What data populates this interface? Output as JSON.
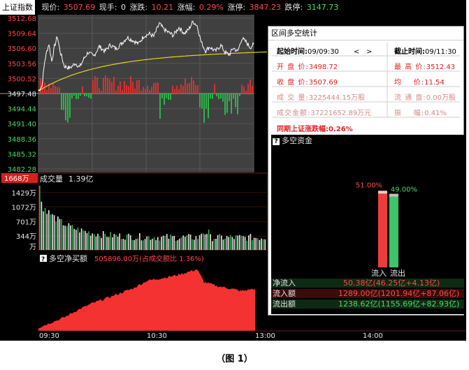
{
  "header": {
    "index_name": "上证指数",
    "price_label": "现价:",
    "price_value": "3507.69",
    "volume_label": "现手:",
    "volume_value": "0",
    "change_label": "涨跌:",
    "change_value": "10.21",
    "pct_label": "涨幅:",
    "pct_value": "0.29%",
    "limit_up_label": "涨停:",
    "limit_up_value": "3847.23",
    "limit_down_label": "跌停:",
    "limit_down_value": "3147.73"
  },
  "price_axis": {
    "ticks": [
      {
        "label": "3512.68",
        "value": 3512.68,
        "color": "#ff4a4a"
      },
      {
        "label": "3509.64",
        "value": 3509.64,
        "color": "#ff4a4a"
      },
      {
        "label": "3506.60",
        "value": 3506.6,
        "color": "#ff4a4a"
      },
      {
        "label": "3503.56",
        "value": 3503.56,
        "color": "#ff4a4a"
      },
      {
        "label": "3500.52",
        "value": 3500.52,
        "color": "#ff4a4a"
      },
      {
        "label": "3497.48",
        "value": 3497.48,
        "color": "#e6e6e6"
      },
      {
        "label": "3494.44",
        "value": 3494.44,
        "color": "#4cd96a"
      },
      {
        "label": "3491.40",
        "value": 3491.4,
        "color": "#4cd96a"
      },
      {
        "label": "3488.36",
        "value": 3488.36,
        "color": "#4cd96a"
      },
      {
        "label": "3485.32",
        "value": 3485.32,
        "color": "#4cd96a"
      },
      {
        "label": "3482.28",
        "value": 3482.28,
        "color": "#4cd96a"
      }
    ]
  },
  "volume_axis": {
    "top_label": "1668万",
    "ticks": [
      {
        "label": "1429万",
        "value": 1429
      },
      {
        "label": "1072万",
        "value": 1072
      },
      {
        "label": "701万",
        "value": 701
      },
      {
        "label": "344万",
        "value": 344
      },
      {
        "label": "万",
        "value": 0
      }
    ],
    "title": "成交量",
    "title_value": "1.39亿"
  },
  "net_buy": {
    "title": "多空净买额",
    "value": "505896.00万(占成交额比 1.36%)"
  },
  "time_axis": {
    "labels": [
      "09:30",
      "10:30",
      "13:00",
      "14:00"
    ]
  },
  "stats_panel": {
    "title": "区间多空统计",
    "start_label": "起始时间:",
    "start_value": "09/09:30",
    "nav_prev": "<",
    "nav_next": ">",
    "end_label": "截止时间:",
    "end_value": "09/11:30",
    "open_label": "开 盘 价:",
    "open_value": "3498.72",
    "high_label": "最 高 价:",
    "high_value": "3512.43",
    "close_label": "收 盘 价:",
    "close_value": "3507.69",
    "avg_label": "均    价:",
    "avg_value": "11.54",
    "volume_label": "成 交 量:",
    "volume_value": "3225444.15万股",
    "float_label": "流 通 盘:",
    "float_value": "0.00万股",
    "amount_label": "成交金额:",
    "amount_value": "37221652.89万元",
    "amp_label": "振    幅:",
    "amp_value": "0.41%",
    "sync_label": "同期上证涨跌幅:",
    "sync_value": "0.26%"
  },
  "flow_panel": {
    "title": "多空资金",
    "inflow_pct": "51.00%",
    "outflow_pct": "49.00%",
    "inflow_fraction": 0.51,
    "outflow_fraction": 0.49,
    "inflow_label": "流入",
    "outflow_label": "流出",
    "rows": [
      {
        "label": "净流入",
        "value": "50.38亿(46.25亿+4.13亿)"
      },
      {
        "label": "流入额",
        "value": "1289.00亿(1201.94亿+87.06亿)"
      },
      {
        "label": "流出额",
        "value": "1238.62亿(1155.69亿+82.93亿)"
      }
    ]
  },
  "colors": {
    "up": "#ff4a4a",
    "down": "#4cd96a",
    "avg_line": "#e8d31a",
    "price_line": "#ffffff",
    "grid": "#4a4a4a",
    "panel_bg": "#404040"
  },
  "caption": "（图 1）"
}
